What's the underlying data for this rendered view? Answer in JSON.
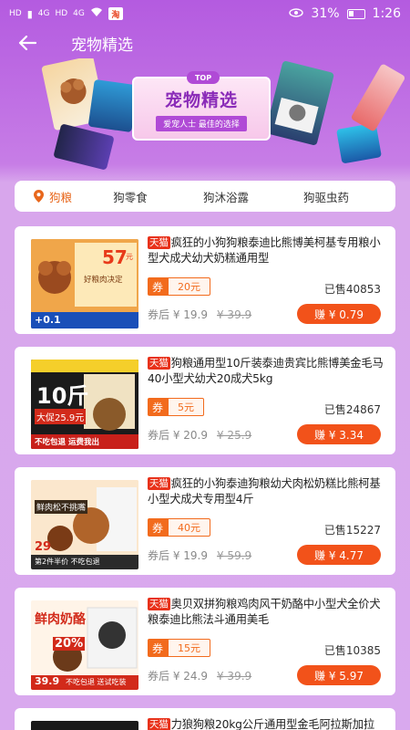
{
  "status_bar": {
    "left_labels": [
      "HD",
      "4G",
      "HD",
      "4G"
    ],
    "battery": "31%",
    "time": "1:26"
  },
  "header": {
    "back_icon": "arrow-left-icon",
    "title": "宠物精选"
  },
  "banner": {
    "badge": "TOP",
    "title": "宠物精选",
    "subtitle": "爱宠人士 最佳的选择"
  },
  "tabs": [
    {
      "label": "狗粮",
      "active": true,
      "icon": "location-pin-icon"
    },
    {
      "label": "狗零食",
      "active": false
    },
    {
      "label": "狗沐浴露",
      "active": false
    },
    {
      "label": "狗驱虫药",
      "active": false
    }
  ],
  "colors": {
    "accent": "#f2521a",
    "tmall": "#e8311a",
    "tab_active": "#e8671c"
  },
  "products": [
    {
      "badge": "天猫",
      "title": "疯狂的小狗狗粮泰迪比熊博美柯基专用粮小型犬成犬幼犬奶糕通用型",
      "coupon_label": "券",
      "coupon_value": "20元",
      "sold": "已售40853",
      "price_label": "券后 ¥ 19.9",
      "original_price": "¥ 39.9",
      "earn": "赚 ¥ 0.79",
      "thumb_text": [
        "57",
        "元",
        "好粮肉决定",
        "+0.1"
      ]
    },
    {
      "badge": "天猫",
      "title": "狗粮通用型10斤装泰迪贵宾比熊博美金毛马40小型犬幼犬20成犬5kg",
      "coupon_label": "券",
      "coupon_value": "5元",
      "sold": "已售24867",
      "price_label": "券后 ¥ 20.9",
      "original_price": "¥ 25.9",
      "earn": "赚 ¥ 3.34",
      "thumb_text": [
        "10斤",
        "大促25.9元",
        "不吃包退 运费我出"
      ]
    },
    {
      "badge": "天猫",
      "title": "疯狂的小狗泰迪狗粮幼犬肉松奶糕比熊柯基小型犬成犬专用型4斤",
      "coupon_label": "券",
      "coupon_value": "40元",
      "sold": "已售15227",
      "price_label": "券后 ¥ 19.9",
      "original_price": "¥ 59.9",
      "earn": "赚 ¥ 4.77",
      "thumb_text": [
        "鲜肉松不挑嘴",
        "29",
        "第2件半价 不吃包退"
      ]
    },
    {
      "badge": "天猫",
      "title": "奥贝双拼狗粮鸡肉风干奶酪中小型犬全价犬粮泰迪比熊法斗通用美毛",
      "coupon_label": "券",
      "coupon_value": "15元",
      "sold": "已售10385",
      "price_label": "券后 ¥ 24.9",
      "original_price": "¥ 39.9",
      "earn": "赚 ¥ 5.97",
      "thumb_text": [
        "鲜肉奶酪",
        "20%",
        "39.9",
        "不吃包退 送试吃装"
      ]
    },
    {
      "badge": "天猫",
      "title": "力狼狗粮20kg公斤通用型金毛阿拉斯加拉",
      "coupon_label": "",
      "coupon_value": "",
      "sold": "",
      "price_label": "",
      "original_price": "",
      "earn": "",
      "thumb_text": []
    }
  ]
}
